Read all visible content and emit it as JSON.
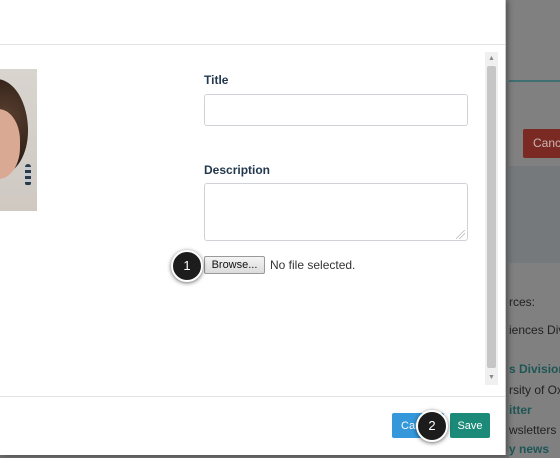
{
  "background": {
    "cancel_label": "Canc",
    "text_lines": [
      {
        "text": "rces:",
        "link": false
      },
      {
        "text": "iences Div",
        "link": false
      },
      {
        "text": "s Division",
        "link": true
      },
      {
        "text": "rsity of Oxf",
        "link": false
      },
      {
        "text": "itter",
        "link": true
      },
      {
        "text": "wsletters",
        "link": false
      },
      {
        "text": "y news",
        "link": true
      }
    ],
    "colors": {
      "cancel": "#e74c3c",
      "link": "#1e7b7b"
    }
  },
  "form": {
    "title_label": "Title",
    "title_value": "",
    "description_label": "Description",
    "description_value": "",
    "browse_label": "Browse...",
    "file_status": "No file selected."
  },
  "footer": {
    "cancel_label": "Can",
    "save_label": "Save"
  },
  "callouts": [
    {
      "number": "1"
    },
    {
      "number": "2"
    }
  ],
  "colors": {
    "save_button": "#1b8a78",
    "cancel_button": "#3498db",
    "label_text": "#23384d"
  }
}
